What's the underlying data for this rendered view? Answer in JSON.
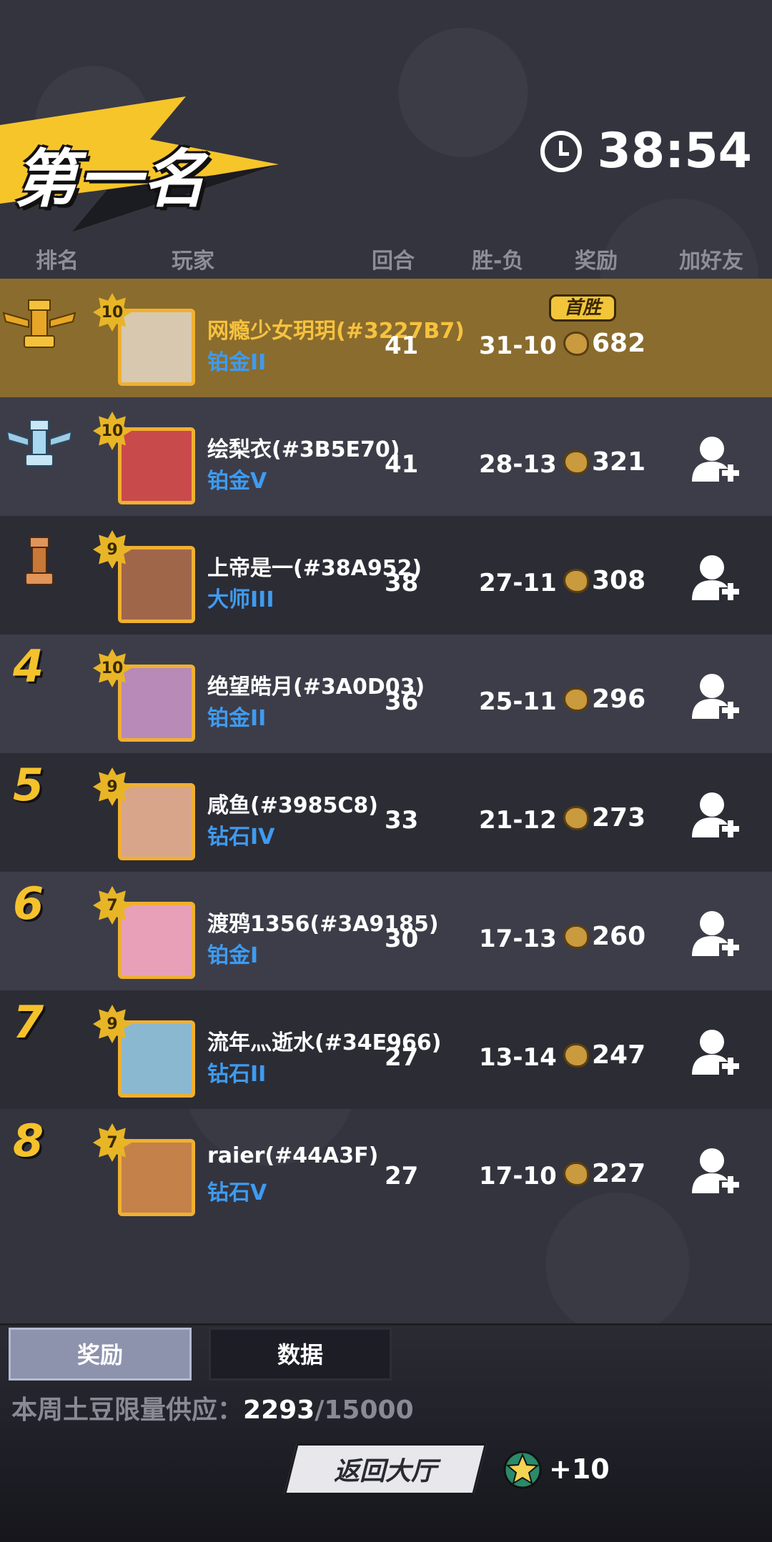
{
  "header": {
    "title": "第一名",
    "timer": "38:54"
  },
  "columns": {
    "rank": "排名",
    "player": "玩家",
    "rounds": "回合",
    "win_loss": "胜-负",
    "reward": "奖励",
    "add_friend": "加好友"
  },
  "first_win_label": "首胜",
  "players": [
    {
      "rank": "1",
      "level": "10",
      "name": "网瘾少女玥玥(#3227B7)",
      "tier": "铂金II",
      "rounds": "41",
      "wl": "31-10",
      "reward": "682",
      "avatar_color": "#d8c8b0"
    },
    {
      "rank": "2",
      "level": "10",
      "name": "绘梨衣(#3B5E70)",
      "tier": "铂金V",
      "rounds": "41",
      "wl": "28-13",
      "reward": "321",
      "avatar_color": "#c94a4a"
    },
    {
      "rank": "3",
      "level": "9",
      "name": "上帝是一(#38A952)",
      "tier": "大师III",
      "rounds": "38",
      "wl": "27-11",
      "reward": "308",
      "avatar_color": "#a0664a"
    },
    {
      "rank": "4",
      "level": "10",
      "name": "绝望皓月(#3A0D03)",
      "tier": "铂金II",
      "rounds": "36",
      "wl": "25-11",
      "reward": "296",
      "avatar_color": "#b78ab8"
    },
    {
      "rank": "5",
      "level": "9",
      "name": "咸鱼(#3985C8)",
      "tier": "钻石IV",
      "rounds": "33",
      "wl": "21-12",
      "reward": "273",
      "avatar_color": "#d9a58a"
    },
    {
      "rank": "6",
      "level": "7",
      "name": "渡鸦1356(#3A9185)",
      "tier": "铂金I",
      "rounds": "30",
      "wl": "17-13",
      "reward": "260",
      "avatar_color": "#e8a0b8"
    },
    {
      "rank": "7",
      "level": "9",
      "name": "流年灬逝水(#34E966)",
      "tier": "钻石II",
      "rounds": "27",
      "wl": "13-14",
      "reward": "247",
      "avatar_color": "#8ab8d0"
    },
    {
      "rank": "8",
      "level": "7",
      "name": "raier(#44A3F)",
      "tier": "钻石V",
      "rounds": "27",
      "wl": "17-10",
      "reward": "227",
      "avatar_color": "#c4824a"
    }
  ],
  "tabs": {
    "reward": "奖励",
    "data": "数据"
  },
  "supply": {
    "label": "本周土豆限量供应：",
    "current": "2293",
    "total": "/15000"
  },
  "footer": {
    "return_label": "返回大厅",
    "bp_value": "+10"
  },
  "colors": {
    "highlight_row": "#8a6c2e",
    "gold_text": "#f6c23e",
    "tier_blue": "#3e9bf0",
    "rank_gold": "#f5c22c",
    "trophy_silver": "#a8d8f0",
    "trophy_bronze": "#c87838"
  }
}
